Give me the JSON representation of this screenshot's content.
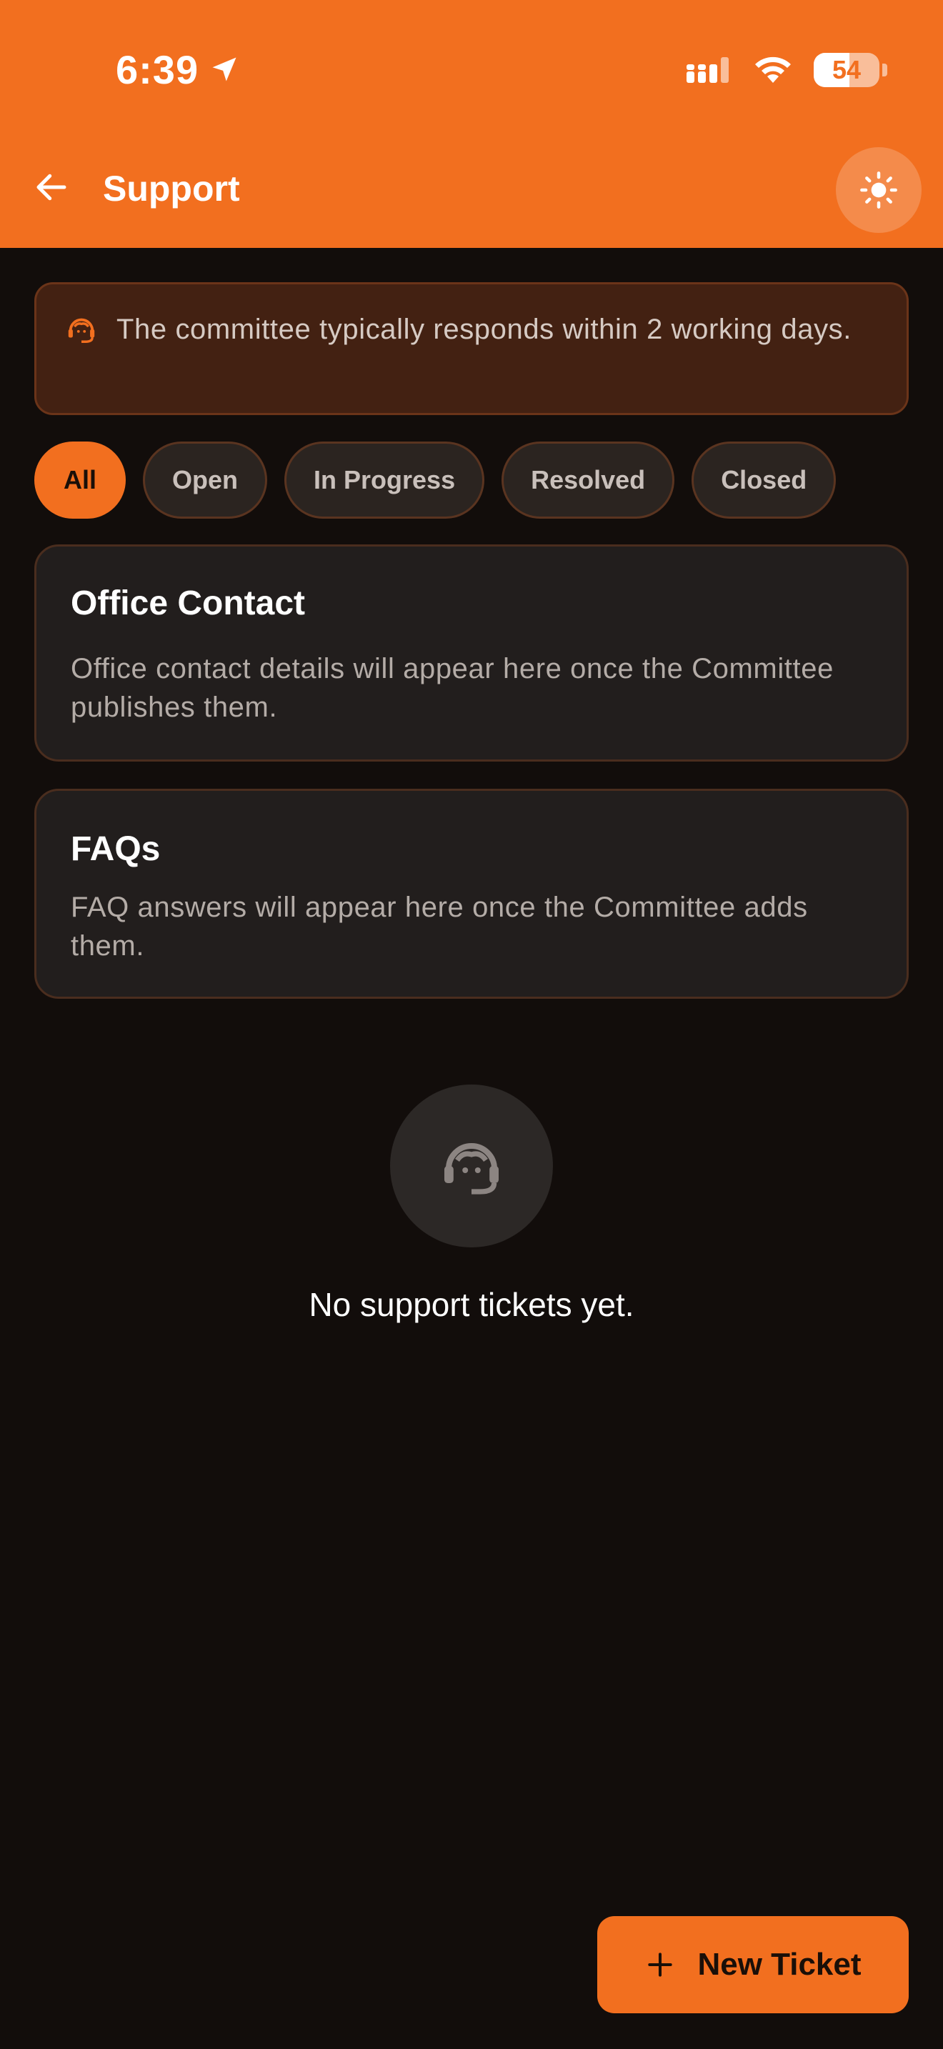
{
  "status_bar": {
    "time": "6:39",
    "battery": "54",
    "battery_level": 0.54
  },
  "header": {
    "title": "Support",
    "back_icon": "arrow-left-icon",
    "theme_icon": "sun-icon"
  },
  "notice": {
    "icon": "headset-agent-icon",
    "text": "The committee typically responds within 2 working days."
  },
  "filters": [
    {
      "label": "All",
      "active": true
    },
    {
      "label": "Open",
      "active": false
    },
    {
      "label": "In Progress",
      "active": false
    },
    {
      "label": "Resolved",
      "active": false
    },
    {
      "label": "Closed",
      "active": false
    }
  ],
  "office_contact": {
    "title": "Office Contact",
    "body": "Office contact details will appear here once the Committee publishes them."
  },
  "faqs": {
    "title": "FAQs",
    "body": "FAQ answers will appear here once the Committee adds them."
  },
  "empty_state": {
    "icon": "headset-agent-icon",
    "text": "No support tickets yet."
  },
  "fab": {
    "icon": "plus-icon",
    "label": "New Ticket"
  },
  "colors": {
    "accent": "#f26f1f",
    "background": "#120d0b",
    "card": "#221e1d"
  }
}
